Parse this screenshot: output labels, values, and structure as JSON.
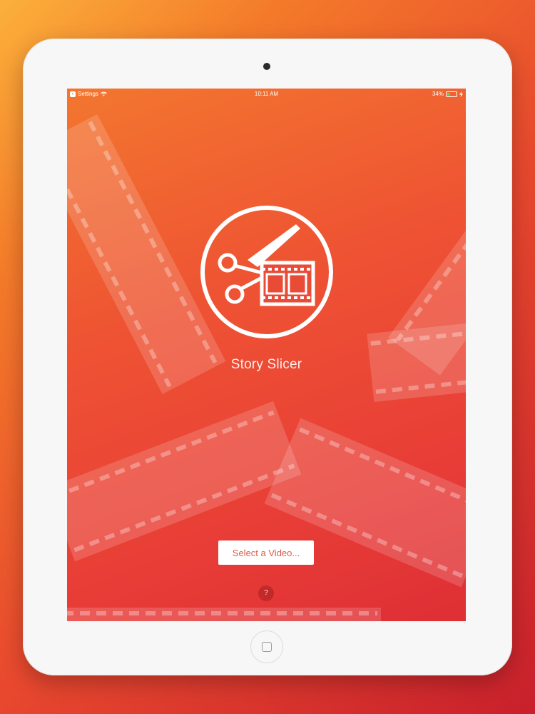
{
  "status_bar": {
    "back_app": "Settings",
    "time": "10:11 AM",
    "battery_percent": "34%",
    "battery_level": 0.34
  },
  "app": {
    "name": "Story Slicer",
    "select_button_label": "Select a Video...",
    "help_label": "?"
  },
  "icons": {
    "logo": "scissors-film-icon",
    "status": [
      "wifi-icon",
      "battery-icon",
      "charging-bolt-icon"
    ],
    "home": "home-button"
  },
  "colors": {
    "background_top": "#fbb03b",
    "background_bottom": "#c8202c",
    "screen_accent": "#ee5233",
    "button_text": "#e05a43"
  }
}
